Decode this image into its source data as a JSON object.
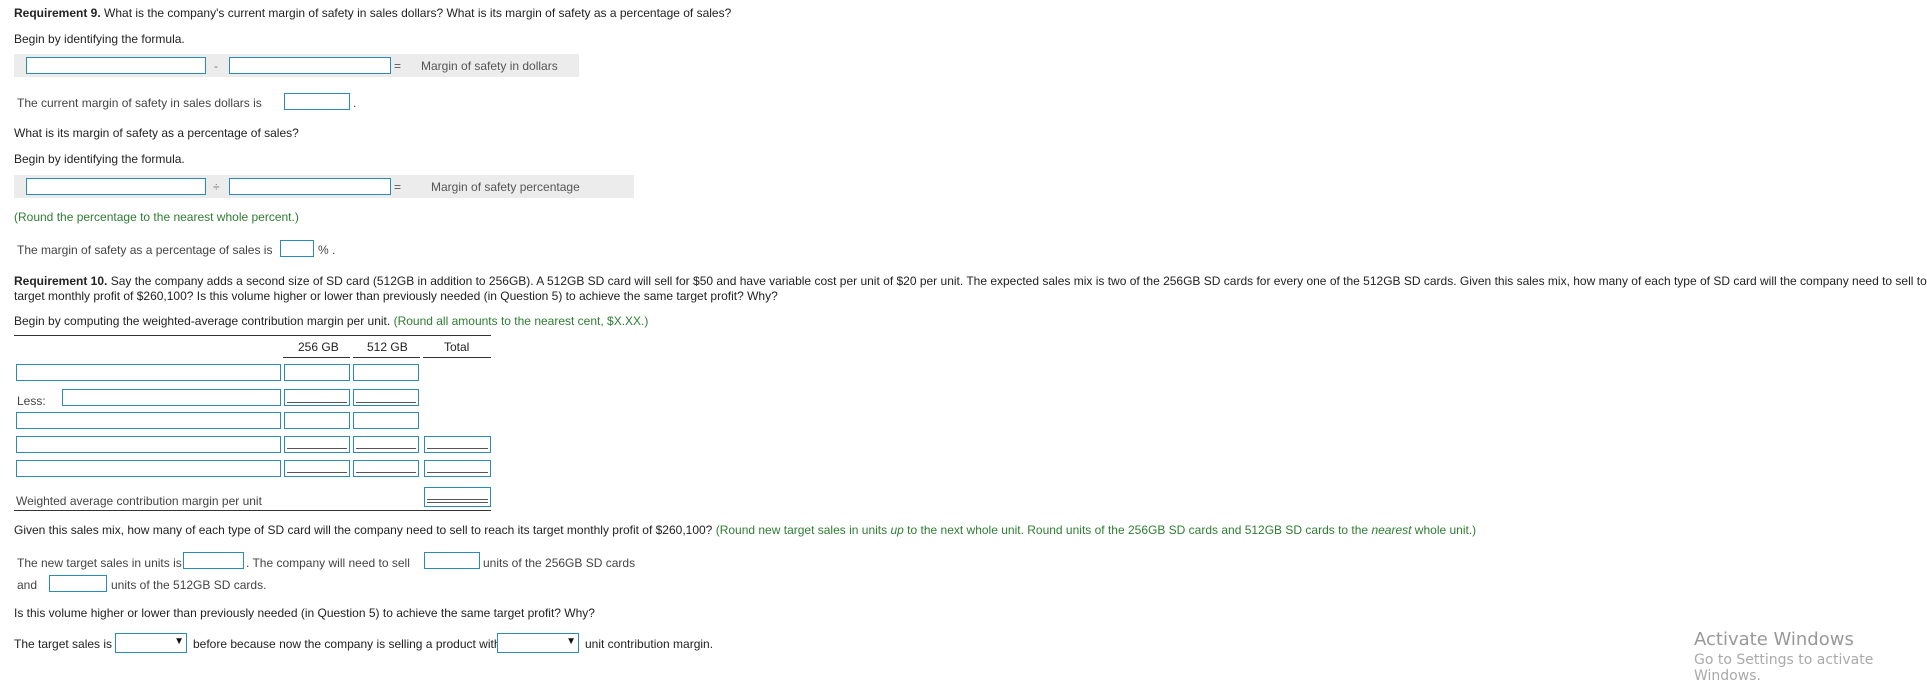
{
  "req9": {
    "label": "Requirement 9.",
    "question": " What is the company's current margin of safety in sales dollars? What is its margin of safety as a percentage of sales?",
    "begin1": "Begin by identifying the formula.",
    "op_minus": "-",
    "eq1": "=",
    "result1": "Margin of safety in dollars",
    "current_text": "The current margin of safety in sales dollars is",
    "period": ".",
    "pct_question": "What is its margin of safety as a percentage of sales?",
    "begin2": "Begin by identifying the formula.",
    "op_div": "÷",
    "eq2": "=",
    "result2": "Margin of safety percentage",
    "round_note": "(Round the percentage to the nearest whole percent.)",
    "pct_text": "The margin of safety as a percentage of sales is",
    "pct_suffix": "% ."
  },
  "req10": {
    "label": "Requirement 10.",
    "question_line1": " Say the company adds a second size of SD card (512GB in addition to 256GB). A 512GB SD card will sell for $50 and have variable cost per unit of $20 per unit. The expected sales mix is two of the 256GB SD cards for every one of the 512GB SD cards. Given this sales mix, how many of each type of SD card will the company need to sell to reach its",
    "question_line2": "target monthly profit of $260,100? Is this volume higher or lower than previously needed (in Question 5) to achieve the same target profit? Why?",
    "begin_text": "Begin by computing the weighted-average contribution margin per unit.",
    "begin_note": " (Round all amounts to the nearest cent, $X.XX.)",
    "table": {
      "col1": "256 GB",
      "col2": "512 GB",
      "col3": "Total",
      "less_label": "Less:",
      "wacm_label": "Weighted average contribution margin per unit"
    },
    "units_question": "Given this sales mix, how many of each type of SD card will the company need to sell to reach its target monthly profit of $260,100?",
    "units_note_a": " (Round new target sales in units ",
    "units_note_up": "up",
    "units_note_b": " to the next whole unit. Round units of the 256GB SD cards and 512GB SD cards to the ",
    "units_note_nearest": "nearest",
    "units_note_c": " whole unit.)",
    "new_target_text": "The new target sales in units is",
    "need_sell_text": ". The company will need to sell",
    "units_256_text": "units of the 256GB SD cards",
    "and_text": "and",
    "units_512_text": "units of the 512GB SD cards.",
    "volume_question": "Is this volume higher or lower than previously needed (in Question 5) to achieve the same target profit? Why?",
    "target_sales_text": "The target sales is",
    "because_text": "before because now the company is selling a product with",
    "ucm_text": "unit contribution margin.",
    "dropdown_arrow": "▼"
  },
  "watermark": {
    "line1": "Activate Windows",
    "line2": "Go to Settings to activate Windows."
  }
}
